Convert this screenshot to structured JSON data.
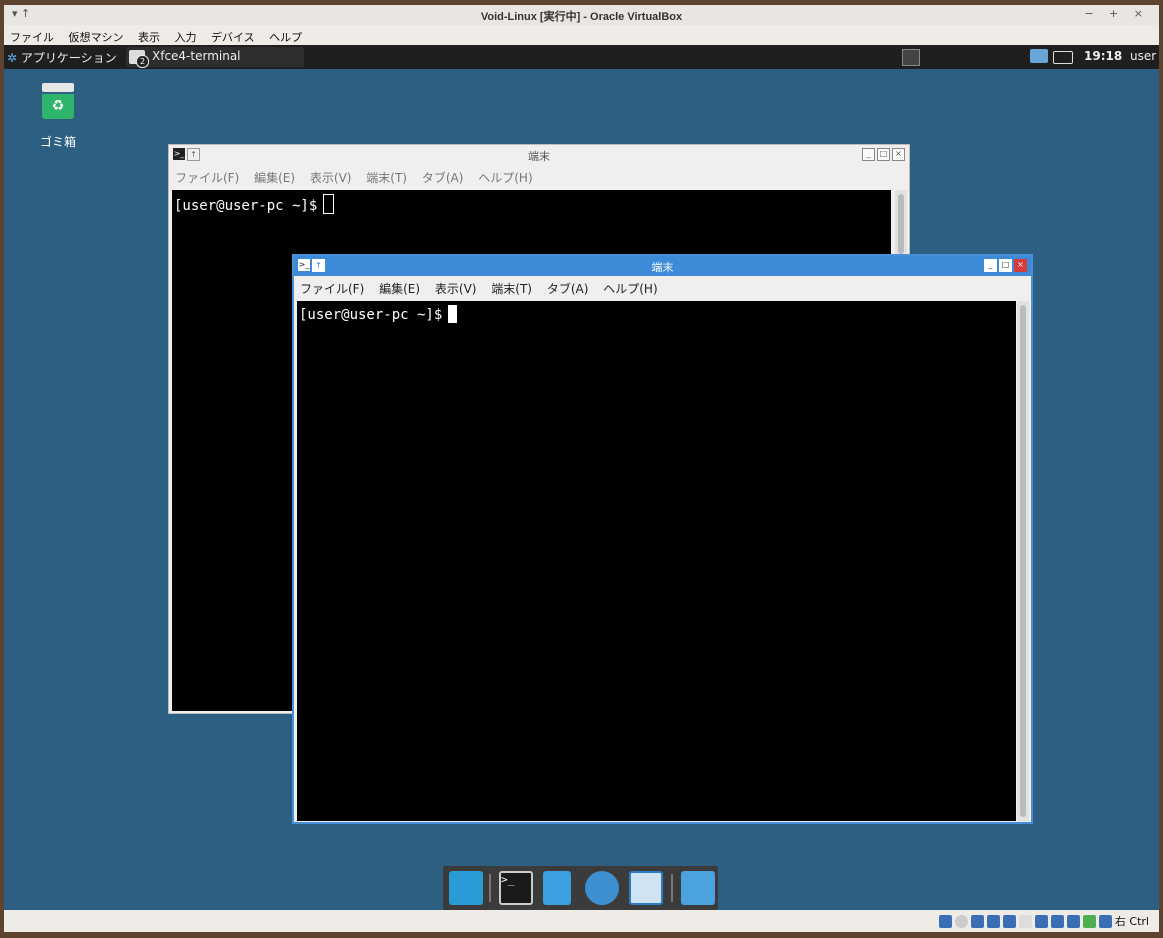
{
  "vbox": {
    "title": "Void-Linux [実行中] - Oracle VirtualBox",
    "title_left": "▾ ↑",
    "title_right": "− + ×",
    "menu": [
      "ファイル",
      "仮想マシン",
      "表示",
      "入力",
      "デバイス",
      "ヘルプ"
    ],
    "host_key": "右 Ctrl"
  },
  "panel": {
    "apps_label": "アプリケーション",
    "task_label": "Xfce4-terminal",
    "task_badge": "2",
    "clock": "19:18",
    "user": "user"
  },
  "desktop": {
    "trash_label": "ゴミ箱"
  },
  "terminal_back": {
    "title": "端末",
    "menu": [
      "ファイル(F)",
      "編集(E)",
      "表示(V)",
      "端末(T)",
      "タブ(A)",
      "ヘルプ(H)"
    ],
    "prompt": "[user@user-pc ~]$"
  },
  "terminal_front": {
    "title": "端末",
    "menu": [
      "ファイル(F)",
      "編集(E)",
      "表示(V)",
      "端末(T)",
      "タブ(A)",
      "ヘルプ(H)"
    ],
    "prompt": "[user@user-pc ~]$"
  },
  "dock": {
    "items": [
      "show-desktop-icon",
      "terminal-icon",
      "file-manager-icon",
      "web-browser-icon",
      "app-finder-icon",
      "folder-icon"
    ]
  },
  "colors": {
    "desktop_bg": "#2d5f82",
    "panel_bg": "#1f1f1f",
    "active_titlebar": "#3c8ad8"
  }
}
